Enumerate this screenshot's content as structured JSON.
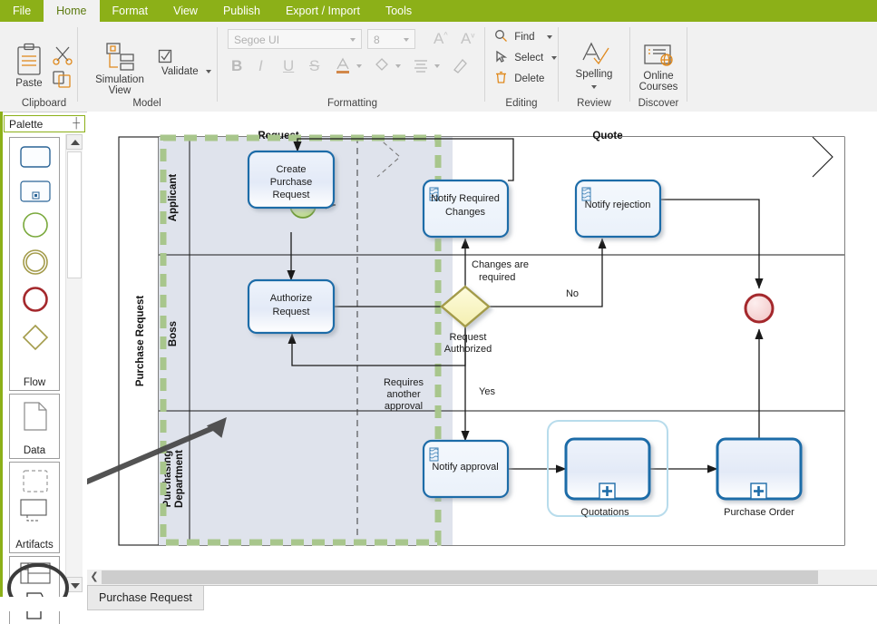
{
  "ribbon": {
    "tabs": [
      {
        "label": "File",
        "active": false
      },
      {
        "label": "Home",
        "active": true
      },
      {
        "label": "Format",
        "active": false
      },
      {
        "label": "View",
        "active": false
      },
      {
        "label": "Publish",
        "active": false
      },
      {
        "label": "Export / Import",
        "active": false
      },
      {
        "label": "Tools",
        "active": false
      }
    ],
    "groups": {
      "clipboard": {
        "name": "Clipboard",
        "paste_label": "Paste",
        "cut_icon": "scissors-icon",
        "copy_icon": "copy-icon"
      },
      "model": {
        "name": "Model",
        "simulation_line1": "Simulation",
        "simulation_line2": "View",
        "validate_label": "Validate"
      },
      "formatting": {
        "name": "Formatting",
        "font_value": "Segoe UI",
        "font_size_value": "8",
        "grow_font": "A",
        "shrink_font": "A",
        "bold": "B",
        "italic": "I",
        "underline": "U",
        "strikethrough": "S",
        "font_color": "A",
        "fill_color": "fill-bucket-icon",
        "align": "align-icon",
        "format_painter": "format-painter-icon"
      },
      "editing": {
        "name": "Editing",
        "find_label": "Find",
        "select_label": "Select",
        "delete_label": "Delete"
      },
      "review": {
        "name": "Review",
        "spelling_label": "Spelling"
      },
      "discover": {
        "name": "Discover",
        "online_line1": "Online",
        "online_line2": "Courses"
      }
    }
  },
  "palette": {
    "title": "Palette",
    "pin_icon": "pin-icon",
    "sections": [
      {
        "label": "Flow",
        "items": [
          {
            "name": "task-shape",
            "kind": "rect",
            "color": "#2a6496"
          },
          {
            "name": "subprocess-shape",
            "kind": "rect-marker",
            "color": "#2a6496"
          },
          {
            "name": "start-event-shape",
            "kind": "circle",
            "color": "#7aa93c"
          },
          {
            "name": "intermediate-event-shape",
            "kind": "double-circle",
            "color": "#a39b4a"
          },
          {
            "name": "end-event-shape",
            "kind": "circle-thick",
            "color": "#a4282c"
          },
          {
            "name": "gateway-shape",
            "kind": "diamond",
            "color": "#a39b4a"
          }
        ]
      },
      {
        "label": "Data",
        "items": [
          {
            "name": "data-object-shape",
            "kind": "doc",
            "color": "#8a8a8a"
          }
        ]
      },
      {
        "label": "Artifacts",
        "items": [
          {
            "name": "group-shape",
            "kind": "dashed-rect",
            "color": "#9a9a9a"
          },
          {
            "name": "annotation-shape",
            "kind": "annotation",
            "color": "#555555"
          }
        ]
      },
      {
        "label": "",
        "items": [
          {
            "name": "pool-shape",
            "kind": "pool",
            "color": "#555555"
          },
          {
            "name": "lane-shape",
            "kind": "lane",
            "color": "#333333",
            "highlighted": true
          }
        ]
      }
    ]
  },
  "canvas": {
    "pool_name": "Purchase Request",
    "lanes": [
      "Applicant",
      "Boss",
      "Purchasing\nDepartment"
    ],
    "phases": [
      "Request",
      "Quote"
    ],
    "selection": {
      "color": "#a8c68c",
      "style": "dashed"
    },
    "nodes": [
      {
        "id": "start",
        "type": "start-event",
        "label": ""
      },
      {
        "id": "create-purchase-request",
        "type": "task",
        "label": "Create\nPurchase\nRequest"
      },
      {
        "id": "authorize-request",
        "type": "task",
        "label": "Authorize\nRequest"
      },
      {
        "id": "notify-required-changes",
        "type": "send-task",
        "label": "Notify Required\nChanges"
      },
      {
        "id": "notify-rejection",
        "type": "send-task",
        "label": "Notify rejection"
      },
      {
        "id": "notify-approval",
        "type": "send-task",
        "label": "Notify approval"
      },
      {
        "id": "request-authorized",
        "type": "gateway",
        "label": "Request\nAuthorized"
      },
      {
        "id": "quotations",
        "type": "subprocess",
        "label": "Quotations"
      },
      {
        "id": "purchase-order",
        "type": "subprocess",
        "label": "Purchase Order"
      },
      {
        "id": "end",
        "type": "end-event",
        "label": ""
      }
    ],
    "flow_labels": [
      "Changes are\nrequired",
      "No",
      "Yes",
      "Requires\nanother\napproval"
    ],
    "annotation_arrow": "pointer-arrow",
    "highlight_circle": "lane-shape-highlight-circle"
  },
  "statusbar": {
    "scroll_left_icon": "chevron-left-icon",
    "document_tab": "Purchase Request"
  },
  "colors": {
    "brand_green": "#8cb018",
    "ribbon_bg": "#f1f1f1",
    "task_border": "#2a6496",
    "lane_fill": "#dfe3ec",
    "selection_green": "#a8c68c",
    "gateway_fill": "#f7f4c0",
    "gateway_border": "#a39b4a",
    "end_event": "#a4282c",
    "start_event": "#7aa93c"
  }
}
